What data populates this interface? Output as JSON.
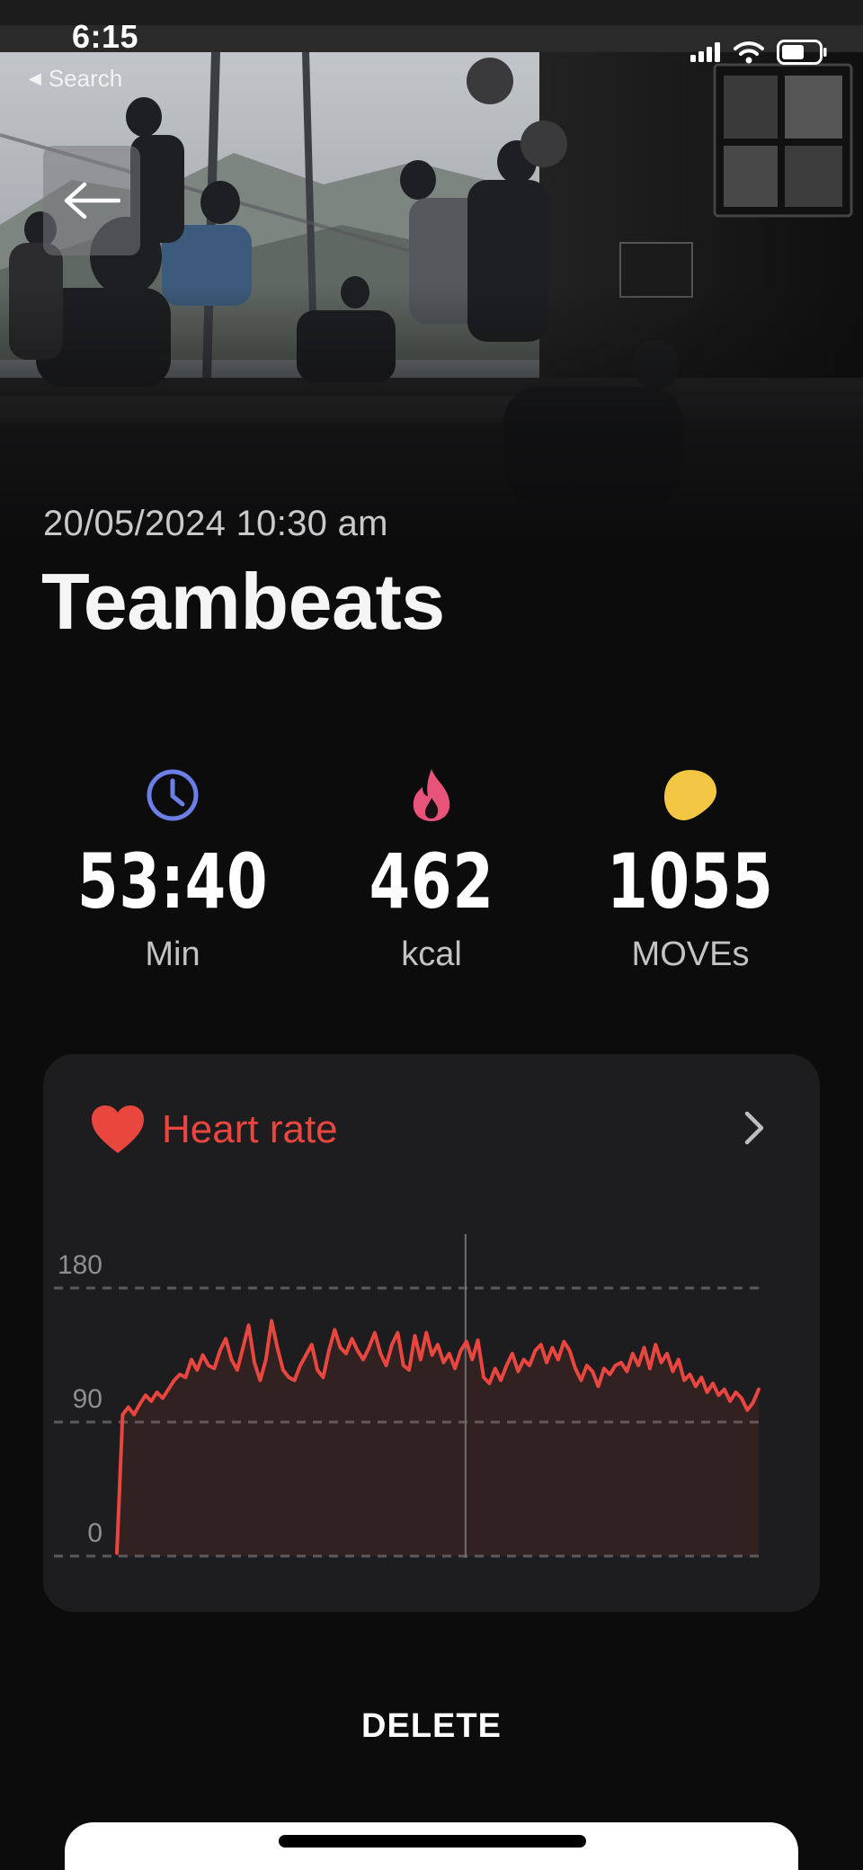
{
  "status_bar": {
    "time": "6:15",
    "back_app_label": "Search"
  },
  "workout": {
    "date_time": "20/05/2024 10:30 am",
    "title": "Teambeats"
  },
  "stats": [
    {
      "icon": "clock-icon",
      "value": "53:40",
      "unit": "Min",
      "color": "#6b7fe6"
    },
    {
      "icon": "flame-icon",
      "value": "462",
      "unit": "kcal",
      "color": "#e8537a"
    },
    {
      "icon": "moves-icon",
      "value": "1055",
      "unit": "MOVEs",
      "color": "#f3c744"
    }
  ],
  "heart_rate_card": {
    "title": "Heart rate",
    "accent_color": "#e8463f",
    "chart_data": {
      "type": "line",
      "y_ticks": [
        "180",
        "90",
        "0"
      ],
      "ylim": [
        0,
        180
      ],
      "grid": "dashed horizontal lines at 0, 90, 180",
      "values": [
        2,
        95,
        100,
        95,
        102,
        108,
        104,
        110,
        106,
        112,
        118,
        122,
        120,
        132,
        125,
        135,
        128,
        126,
        138,
        146,
        132,
        125,
        140,
        155,
        130,
        118,
        132,
        158,
        140,
        125,
        120,
        118,
        128,
        135,
        142,
        125,
        120,
        138,
        152,
        140,
        136,
        146,
        138,
        132,
        140,
        150,
        136,
        128,
        142,
        150,
        128,
        125,
        148,
        132,
        150,
        135,
        142,
        130,
        136,
        126,
        138,
        144,
        132,
        145,
        120,
        116,
        126,
        118,
        128,
        136,
        124,
        132,
        128,
        138,
        142,
        130,
        140,
        132,
        144,
        138,
        126,
        118,
        128,
        124,
        114,
        126,
        122,
        128,
        130,
        124,
        136,
        128,
        140,
        126,
        142,
        130,
        136,
        124,
        132,
        118,
        122,
        114,
        120,
        110,
        116,
        108,
        112,
        104,
        110,
        106,
        98,
        103,
        112
      ]
    }
  },
  "actions": {
    "delete_label": "DELETE"
  }
}
